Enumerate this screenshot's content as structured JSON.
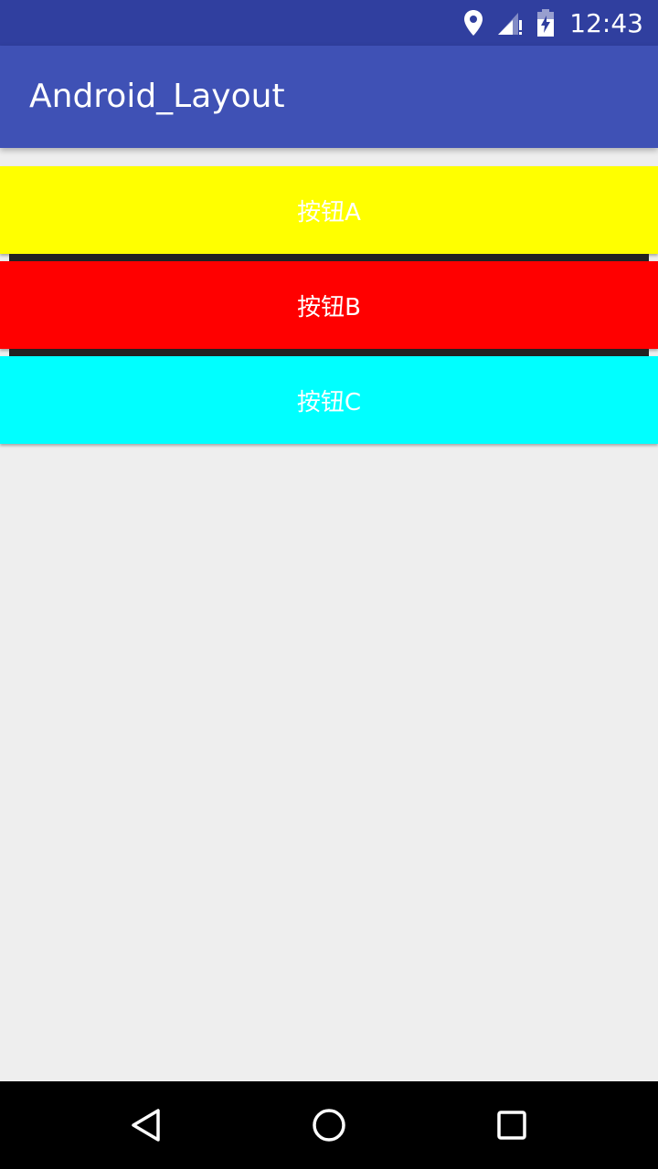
{
  "status_bar": {
    "time": "12:43",
    "icons": [
      "location-icon",
      "signal-icon",
      "battery-charging-icon"
    ]
  },
  "app_bar": {
    "title": "Android_Layout"
  },
  "buttons": [
    {
      "label": "按钮A",
      "color": "#ffff00"
    },
    {
      "label": "按钮B",
      "color": "#ff0000"
    },
    {
      "label": "按钮C",
      "color": "#00ffff"
    }
  ],
  "nav_bar": {
    "icons": [
      "back-icon",
      "home-icon",
      "recents-icon"
    ]
  },
  "colors": {
    "status_bar": "#303f9f",
    "app_bar": "#3f51b5",
    "background": "#eeeeee"
  }
}
